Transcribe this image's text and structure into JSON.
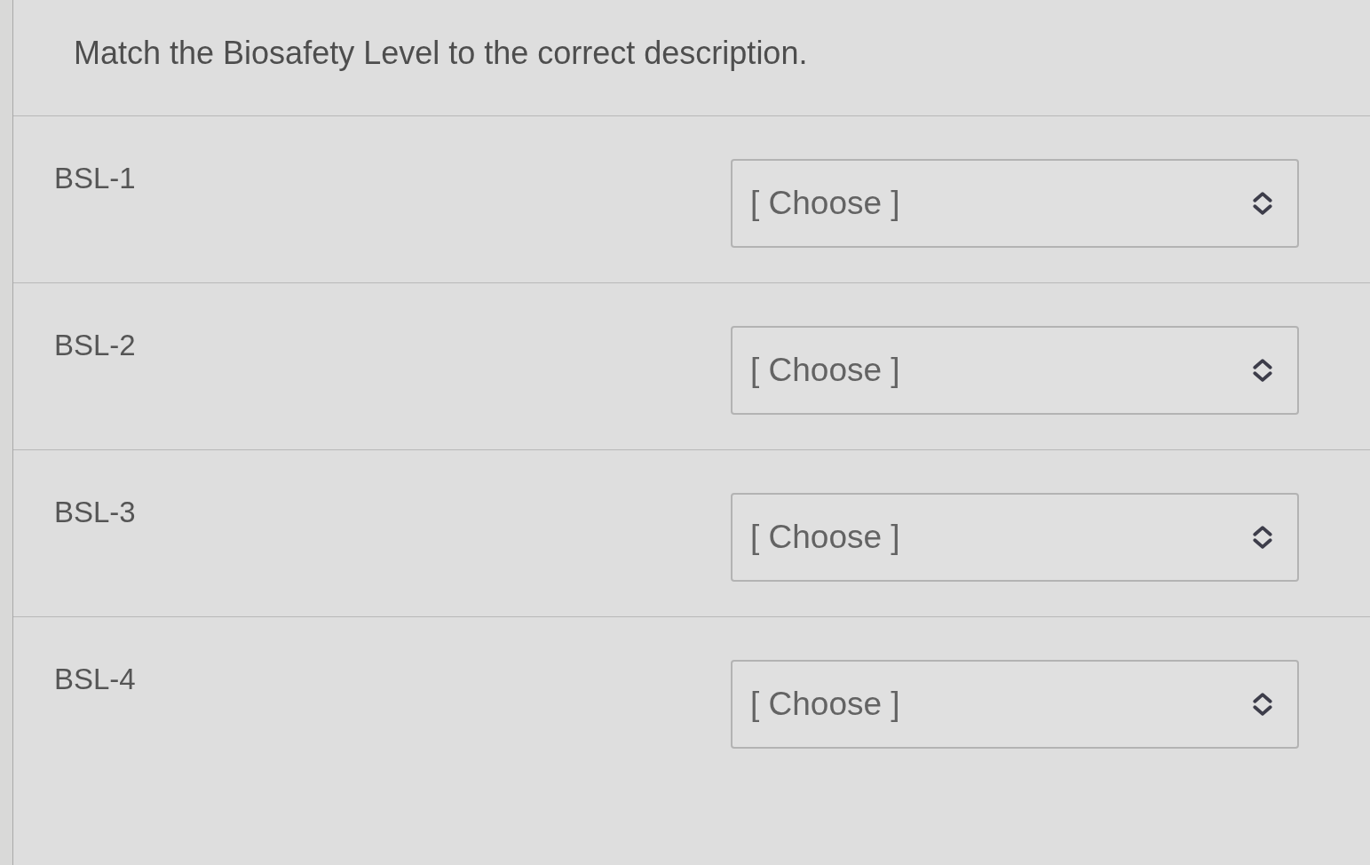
{
  "question": "Match the Biosafety Level to the correct description.",
  "items": [
    {
      "label": "BSL-1",
      "dropdown": {
        "value": "[ Choose ]"
      }
    },
    {
      "label": "BSL-2",
      "dropdown": {
        "value": "[ Choose ]"
      }
    },
    {
      "label": "BSL-3",
      "dropdown": {
        "value": "[ Choose ]"
      }
    },
    {
      "label": "BSL-4",
      "dropdown": {
        "value": "[ Choose ]"
      }
    }
  ]
}
